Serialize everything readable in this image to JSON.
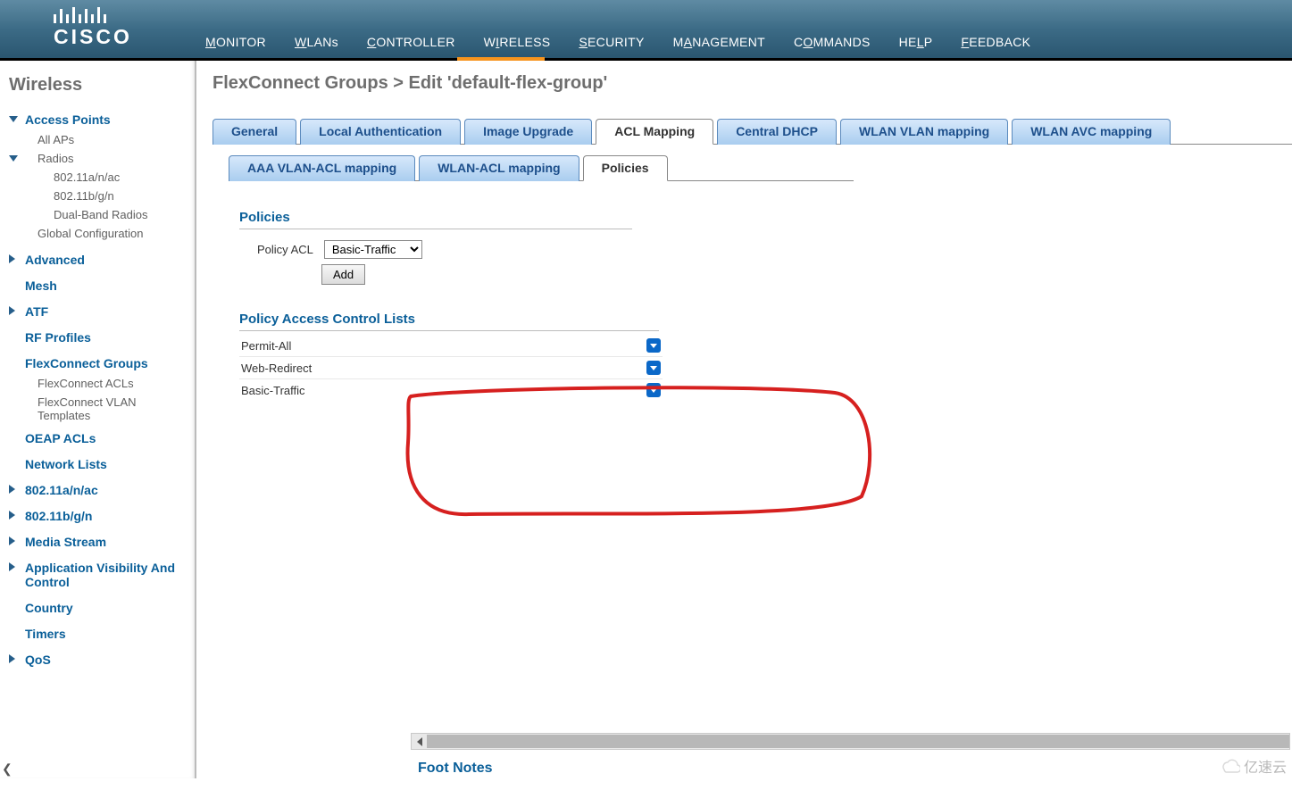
{
  "brand": "CISCO",
  "topnav": [
    "MONITOR",
    "WLANs",
    "CONTROLLER",
    "WIRELESS",
    "SECURITY",
    "MANAGEMENT",
    "COMMANDS",
    "HELP",
    "FEEDBACK"
  ],
  "topnav_active": "WIRELESS",
  "sidebar": {
    "title": "Wireless",
    "access_points": {
      "label": "Access Points",
      "all": "All APs",
      "radios": "Radios",
      "r1": "802.11a/n/ac",
      "r2": "802.11b/g/n",
      "r3": "Dual-Band Radios",
      "global": "Global Configuration"
    },
    "advanced": "Advanced",
    "mesh": "Mesh",
    "atf": "ATF",
    "rf": "RF Profiles",
    "flex": {
      "label": "FlexConnect Groups",
      "acls": "FlexConnect ACLs",
      "vlan": "FlexConnect VLAN Templates"
    },
    "oeap": "OEAP ACLs",
    "netlists": "Network Lists",
    "r11a": "802.11a/n/ac",
    "r11b": "802.11b/g/n",
    "media": "Media Stream",
    "avc": "Application Visibility And Control",
    "country": "Country",
    "timers": "Timers",
    "qos": "QoS"
  },
  "breadcrumb": "FlexConnect Groups > Edit    'default-flex-group'",
  "tabs": [
    "General",
    "Local Authentication",
    "Image Upgrade",
    "ACL Mapping",
    "Central DHCP",
    "WLAN VLAN mapping",
    "WLAN AVC mapping"
  ],
  "tabs_active": "ACL Mapping",
  "subtabs": [
    "AAA VLAN-ACL mapping",
    "WLAN-ACL mapping",
    "Policies"
  ],
  "subtabs_active": "Policies",
  "policies": {
    "heading": "Policies",
    "label": "Policy ACL",
    "select_value": "Basic-Traffic",
    "add": "Add",
    "list_title": "Policy Access Control Lists",
    "items": [
      "Permit-All",
      "Web-Redirect",
      "Basic-Traffic"
    ]
  },
  "footnotes": "Foot Notes",
  "watermark": "亿速云"
}
